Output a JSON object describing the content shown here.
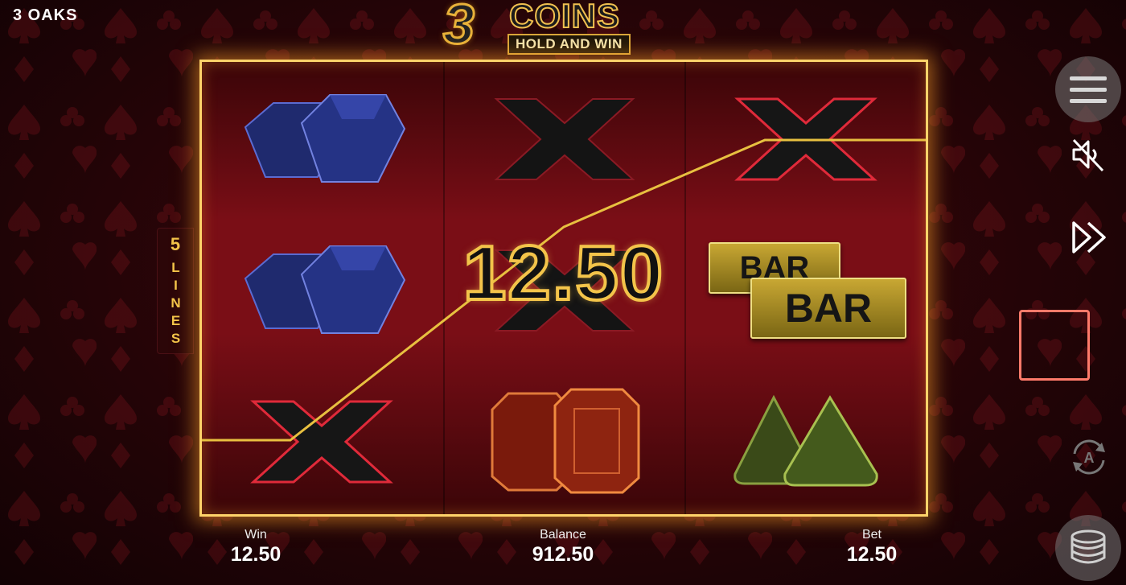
{
  "brand": "3 OAKS",
  "logo": {
    "number": "3",
    "title": "COINS",
    "subtitle": "HOLD AND WIN"
  },
  "lines_badge": {
    "count": "5",
    "word": "LINES"
  },
  "reels": [
    [
      "sapphire",
      "sapphire",
      "x"
    ],
    [
      "x",
      "x",
      "ruby"
    ],
    [
      "x",
      "bar",
      "emerald"
    ]
  ],
  "bar_symbol": {
    "top": "BAR",
    "bottom": "BAR"
  },
  "win_amount": "12.50",
  "stats": {
    "win_label": "Win",
    "win_value": "12.50",
    "balance_label": "Balance",
    "balance_value": "912.50",
    "bet_label": "Bet",
    "bet_value": "12.50"
  },
  "controls": {
    "menu_icon": "hamburger-icon",
    "sound_icon": "speaker-muted-icon",
    "turbo_icon": "fast-forward-icon",
    "spin_icon": "square-icon",
    "auto_icon": "autoplay-icon",
    "bet_icon": "coin-stack-icon",
    "auto_letter": "A"
  },
  "colors": {
    "gold": "#f3c44a",
    "frame": "#ffd36a",
    "spin_border": "#ff7a6a",
    "background": "#2a0508"
  }
}
